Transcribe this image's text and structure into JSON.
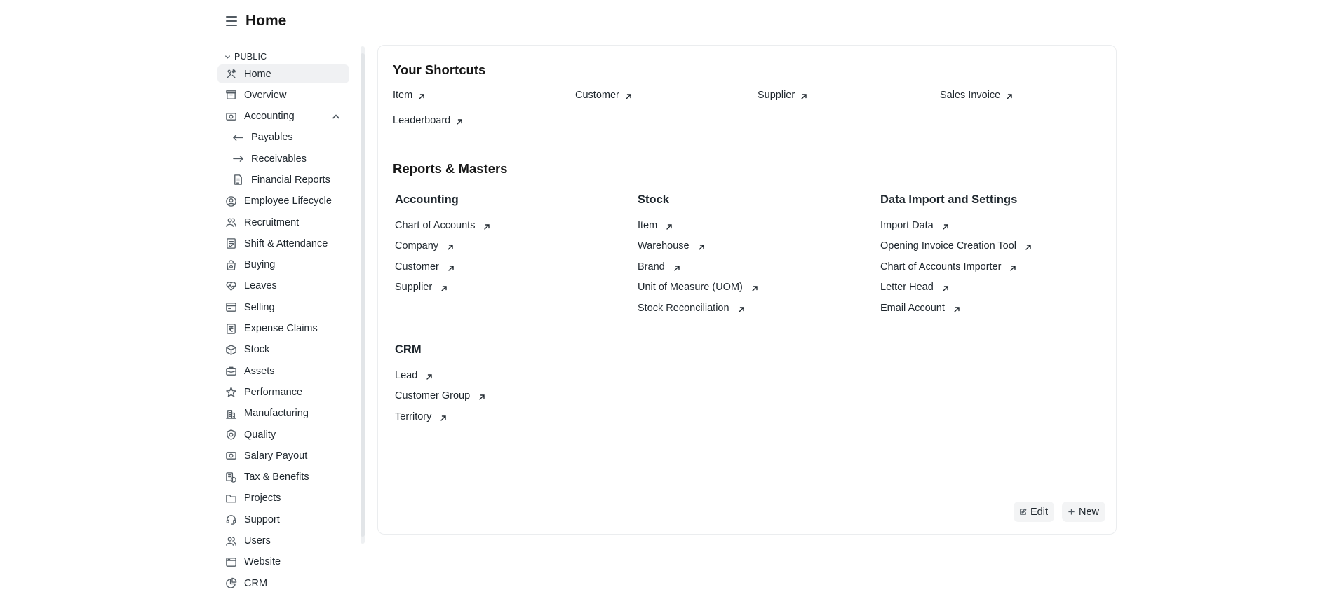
{
  "page": {
    "title": "Home"
  },
  "sidebar": {
    "section_label": "PUBLIC",
    "items": [
      {
        "label": "Home",
        "icon": "tools-icon",
        "active": true
      },
      {
        "label": "Overview",
        "icon": "box-icon"
      },
      {
        "label": "Accounting",
        "icon": "money-icon",
        "expanded": true
      },
      {
        "label": "Payables",
        "icon": "arrow-left-icon",
        "child": true
      },
      {
        "label": "Receivables",
        "icon": "arrow-right-icon",
        "child": true
      },
      {
        "label": "Financial Reports",
        "icon": "file-icon",
        "child": true
      },
      {
        "label": "Employee Lifecycle",
        "icon": "user-circle-icon"
      },
      {
        "label": "Recruitment",
        "icon": "users-icon"
      },
      {
        "label": "Shift & Attendance",
        "icon": "checklist-icon"
      },
      {
        "label": "Buying",
        "icon": "shopping-bag-icon"
      },
      {
        "label": "Leaves",
        "icon": "heartbeat-icon"
      },
      {
        "label": "Selling",
        "icon": "card-icon"
      },
      {
        "label": "Expense Claims",
        "icon": "rupee-icon"
      },
      {
        "label": "Stock",
        "icon": "cube-icon"
      },
      {
        "label": "Assets",
        "icon": "briefcase-icon"
      },
      {
        "label": "Performance",
        "icon": "star-icon"
      },
      {
        "label": "Manufacturing",
        "icon": "building-icon"
      },
      {
        "label": "Quality",
        "icon": "shield-icon"
      },
      {
        "label": "Salary Payout",
        "icon": "money-icon"
      },
      {
        "label": "Tax & Benefits",
        "icon": "receipt-icon"
      },
      {
        "label": "Projects",
        "icon": "folder-icon"
      },
      {
        "label": "Support",
        "icon": "headset-icon"
      },
      {
        "label": "Users",
        "icon": "users-icon"
      },
      {
        "label": "Website",
        "icon": "browser-icon"
      },
      {
        "label": "CRM",
        "icon": "pie-chart-icon"
      }
    ]
  },
  "shortcuts": {
    "title": "Your Shortcuts",
    "items": [
      "Item",
      "Customer",
      "Supplier",
      "Sales Invoice",
      "Leaderboard"
    ]
  },
  "reports": {
    "title": "Reports & Masters",
    "columns": [
      {
        "title": "Accounting",
        "links": [
          "Chart of Accounts",
          "Company",
          "Customer",
          "Supplier"
        ]
      },
      {
        "title": "Stock",
        "links": [
          "Item",
          "Warehouse",
          "Brand",
          "Unit of Measure (UOM)",
          "Stock Reconciliation"
        ]
      },
      {
        "title": "Data Import and Settings",
        "links": [
          "Import Data",
          "Opening Invoice Creation Tool",
          "Chart of Accounts Importer",
          "Letter Head",
          "Email Account"
        ]
      },
      {
        "title": "CRM",
        "links": [
          "Lead",
          "Customer Group",
          "Territory"
        ]
      }
    ]
  },
  "actions": {
    "edit_label": "Edit",
    "new_label": "New"
  }
}
